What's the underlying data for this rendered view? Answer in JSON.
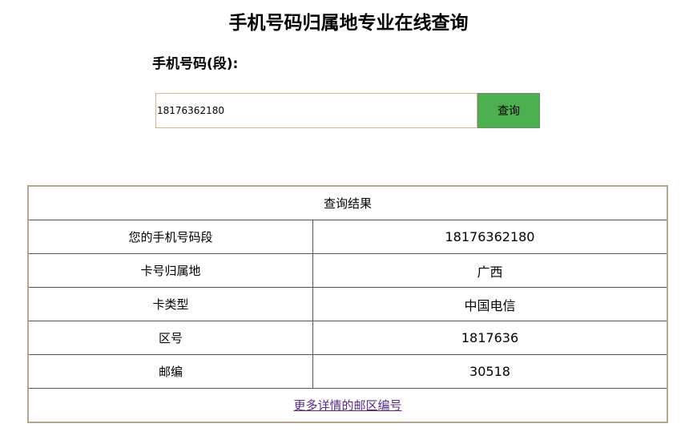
{
  "page": {
    "title": "手机号码归属地专业在线查询"
  },
  "search": {
    "label": "手机号码(段):",
    "value": "18176362180",
    "button_label": "查询",
    "button_color": "#4caf50"
  },
  "result": {
    "header": "查询结果",
    "rows": [
      {
        "label": "您的手机号码段",
        "value": "18176362180"
      },
      {
        "label": "卡号归属地",
        "value": "广西"
      },
      {
        "label": "卡类型",
        "value": "中国电信"
      },
      {
        "label": "区号",
        "value": "1817636"
      },
      {
        "label": "邮编",
        "value": "30518"
      }
    ],
    "link_text": "更多详情的邮区编号",
    "link_color": "#5a2a8a"
  }
}
